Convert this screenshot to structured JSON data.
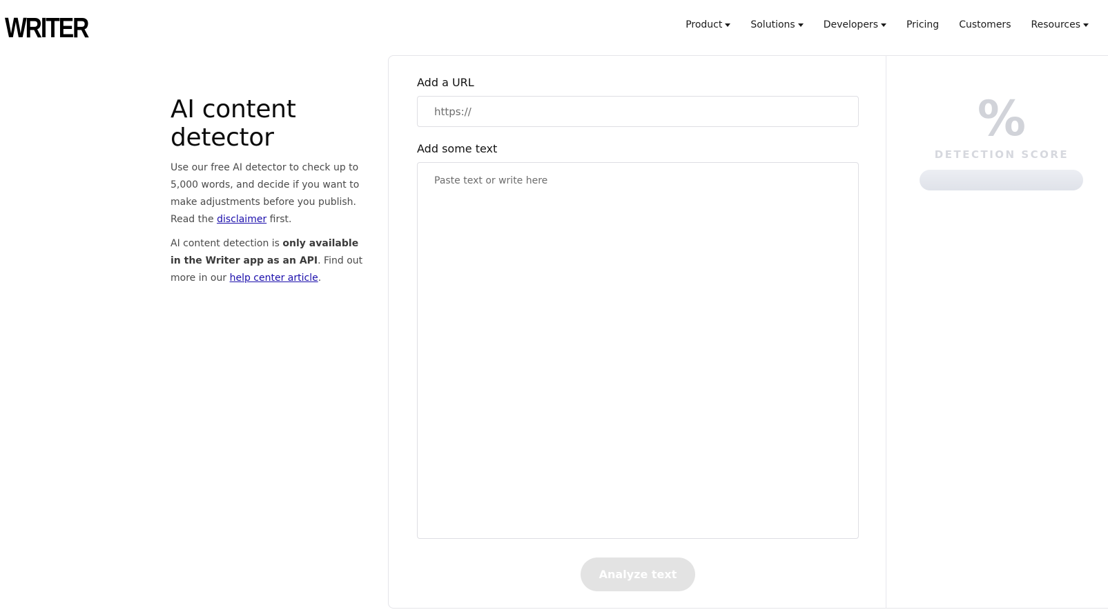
{
  "header": {
    "logo": "WRITER",
    "nav": [
      {
        "label": "Product",
        "dropdown": true
      },
      {
        "label": "Solutions",
        "dropdown": true
      },
      {
        "label": "Developers",
        "dropdown": true
      },
      {
        "label": "Pricing",
        "dropdown": false
      },
      {
        "label": "Customers",
        "dropdown": false
      },
      {
        "label": "Resources",
        "dropdown": true
      }
    ]
  },
  "intro": {
    "title": "AI content detector",
    "desc1_before": "Use our free AI detector to check up to 5,000 words, and decide if you want to make adjustments before you publish. Read the ",
    "disclaimer_link": "disclaimer",
    "desc1_after": " first.",
    "desc2_before": "AI content detection is ",
    "desc2_bold": "only available in the Writer app as an API",
    "desc2_middle": ". Find out more in our ",
    "help_link": "help center article",
    "desc2_after": "."
  },
  "form": {
    "url_label": "Add a URL",
    "url_placeholder": "https://",
    "text_label": "Add some text",
    "text_placeholder": "Paste text or write here",
    "analyze_label": "Analyze text"
  },
  "score": {
    "symbol": "%",
    "label": "DETECTION SCORE"
  },
  "colors": {
    "link": "#1a0dab",
    "button_disabled": "#e3e3e3",
    "score_placeholder": "#d1d3d9"
  }
}
